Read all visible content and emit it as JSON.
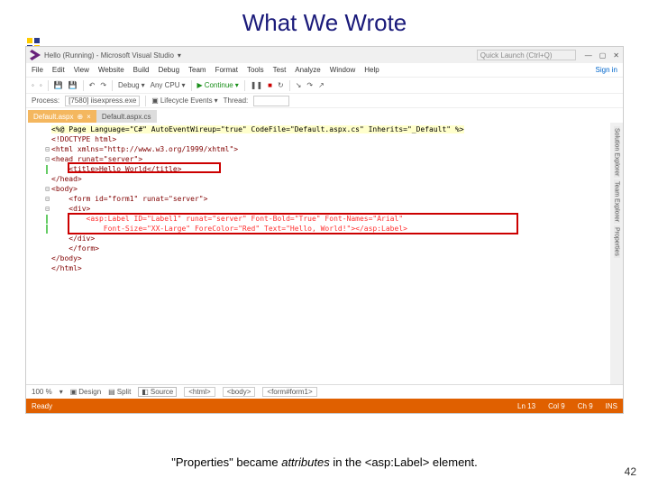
{
  "slide": {
    "title": "What We Wrote",
    "caption_quoted": "Properties",
    "caption_mid": " became ",
    "caption_em": "attributes",
    "caption_tail": " in the <asp:Label> element.",
    "page_number": "42"
  },
  "vs": {
    "window_title": "Hello (Running) - Microsoft Visual Studio",
    "quick_launch_placeholder": "Quick Launch (Ctrl+Q)",
    "sign_in": "Sign in",
    "menus": [
      "File",
      "Edit",
      "View",
      "Website",
      "Build",
      "Debug",
      "Team",
      "Format",
      "Tools",
      "Test",
      "Analyze",
      "Window",
      "Help"
    ],
    "toolbar": {
      "debug": "Debug",
      "anycpu": "Any CPU",
      "continue": "Continue"
    },
    "process_label": "Process:",
    "process_value": "[7580] iisexpress.exe",
    "lifecycle": "Lifecycle Events",
    "thread": "Thread:",
    "tabs": {
      "active": "Default.aspx",
      "inactive": "Default.aspx.cs"
    },
    "right_tabs": [
      "Solution Explorer",
      "Team Explorer",
      "Properties"
    ],
    "bottom": {
      "zoom": "100 %",
      "design": "Design",
      "split": "Split",
      "source": "Source",
      "crumbs": [
        "<html>",
        "<body>",
        "<form#form1>"
      ]
    },
    "status": {
      "ready": "Ready",
      "ln": "Ln 13",
      "col": "Col 9",
      "ch": "Ch 9",
      "ins": "INS"
    }
  },
  "code": {
    "l1a": "<%@ ",
    "l1b": "Page Language=\"C#\" AutoEventWireup=\"true\" CodeFile=\"Default.aspx.cs\" Inherits=\"_Default\" %>",
    "l2": "<!DOCTYPE html>",
    "l3": "<html xmlns=\"http://www.w3.org/1999/xhtml\">",
    "l4": "<head runat=\"server\">",
    "l5": "    <title>Hello World</title>",
    "l6": "</head>",
    "l7": "<body>",
    "l8": "    <form id=\"form1\" runat=\"server\">",
    "l9": "    <div>",
    "l10": "        <asp:Label ID=\"Label1\" runat=\"server\" Font-Bold=\"True\" Font-Names=\"Arial\"",
    "l11": "            Font-Size=\"XX-Large\" ForeColor=\"Red\" Text=\"Hello, World!\"></asp:Label>",
    "l12": "    </div>",
    "l13": "    </form>",
    "l14": "</body>",
    "l15": "</html>"
  }
}
